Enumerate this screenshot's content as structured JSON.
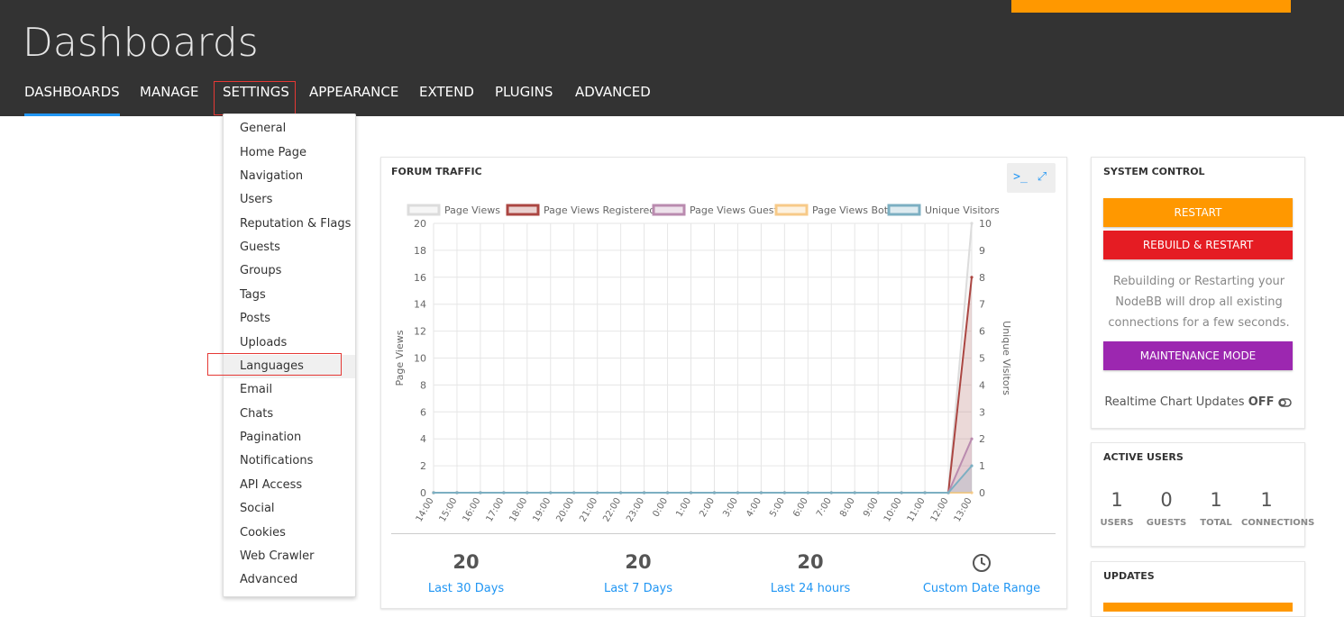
{
  "header": {
    "title": "Dashboards",
    "nav": [
      "DASHBOARDS",
      "MANAGE",
      "SETTINGS",
      "APPEARANCE",
      "EXTEND",
      "PLUGINS",
      "ADVANCED"
    ]
  },
  "settings_menu": [
    "General",
    "Home Page",
    "Navigation",
    "Users",
    "Reputation & Flags",
    "Guests",
    "Groups",
    "Tags",
    "Posts",
    "Uploads",
    "Languages",
    "Email",
    "Chats",
    "Pagination",
    "Notifications",
    "API Access",
    "Social",
    "Cookies",
    "Web Crawler",
    "Advanced"
  ],
  "traffic": {
    "title": "FORUM TRAFFIC",
    "terminal_icon": "terminal-icon",
    "expand_icon": "expand-icon",
    "stats": [
      {
        "value": "20",
        "label": "Last 30 Days"
      },
      {
        "value": "20",
        "label": "Last 7 Days"
      },
      {
        "value": "20",
        "label": "Last 24 hours"
      },
      {
        "value": "",
        "label": "Custom Date Range"
      }
    ]
  },
  "chart_data": {
    "type": "line",
    "x": [
      "14:00",
      "15:00",
      "16:00",
      "17:00",
      "18:00",
      "19:00",
      "20:00",
      "21:00",
      "22:00",
      "23:00",
      "0:00",
      "1:00",
      "2:00",
      "3:00",
      "4:00",
      "5:00",
      "6:00",
      "7:00",
      "8:00",
      "9:00",
      "10:00",
      "11:00",
      "12:00",
      "13:00"
    ],
    "series": [
      {
        "name": "Page Views",
        "axis": "left",
        "color": "#dcdcdc",
        "values": [
          0,
          0,
          0,
          0,
          0,
          0,
          0,
          0,
          0,
          0,
          0,
          0,
          0,
          0,
          0,
          0,
          0,
          0,
          0,
          0,
          0,
          0,
          0,
          20
        ]
      },
      {
        "name": "Page Views Registered",
        "axis": "left",
        "color": "#ab4642",
        "values": [
          0,
          0,
          0,
          0,
          0,
          0,
          0,
          0,
          0,
          0,
          0,
          0,
          0,
          0,
          0,
          0,
          0,
          0,
          0,
          0,
          0,
          0,
          0,
          16
        ]
      },
      {
        "name": "Page Views Guest",
        "axis": "left",
        "color": "#ba8baf",
        "values": [
          0,
          0,
          0,
          0,
          0,
          0,
          0,
          0,
          0,
          0,
          0,
          0,
          0,
          0,
          0,
          0,
          0,
          0,
          0,
          0,
          0,
          0,
          0,
          4
        ]
      },
      {
        "name": "Page Views Bot",
        "axis": "left",
        "color": "#f7ca88",
        "values": [
          0,
          0,
          0,
          0,
          0,
          0,
          0,
          0,
          0,
          0,
          0,
          0,
          0,
          0,
          0,
          0,
          0,
          0,
          0,
          0,
          0,
          0,
          0,
          0
        ]
      },
      {
        "name": "Unique Visitors",
        "axis": "right",
        "color": "#7cafc2",
        "values": [
          0,
          0,
          0,
          0,
          0,
          0,
          0,
          0,
          0,
          0,
          0,
          0,
          0,
          0,
          0,
          0,
          0,
          0,
          0,
          0,
          0,
          0,
          0,
          1
        ]
      }
    ],
    "ylabel": "Page Views",
    "y2label": "Unique Visitors",
    "ylim": [
      0,
      20
    ],
    "y2lim": [
      0,
      10
    ],
    "yticks": [
      0,
      2,
      4,
      6,
      8,
      10,
      12,
      14,
      16,
      18,
      20
    ],
    "y2ticks": [
      0,
      1,
      2,
      3,
      4,
      5,
      6,
      7,
      8,
      9,
      10
    ],
    "grid": true,
    "legend": "top"
  },
  "system": {
    "title": "SYSTEM CONTROL",
    "restart": "RESTART",
    "rebuild": "REBUILD & RESTART",
    "note": "Rebuilding or Restarting your NodeBB will drop all existing connections for a few seconds.",
    "maintenance": "MAINTENANCE MODE",
    "realtime_label": "Realtime Chart Updates",
    "realtime_value": "OFF",
    "toggle_icon": "toggle-off-icon"
  },
  "active_users": {
    "title": "ACTIVE USERS",
    "items": [
      {
        "value": "1",
        "label": "USERS"
      },
      {
        "value": "0",
        "label": "GUESTS"
      },
      {
        "value": "1",
        "label": "TOTAL"
      },
      {
        "value": "1",
        "label": "CONNECTIONS"
      }
    ]
  },
  "updates": {
    "title": "UPDATES"
  },
  "colors": {
    "header": "#333333",
    "accent": "#2196f3",
    "restart": "#ff9800",
    "rebuild": "#e51c23",
    "maintenance": "#9c27b0"
  }
}
